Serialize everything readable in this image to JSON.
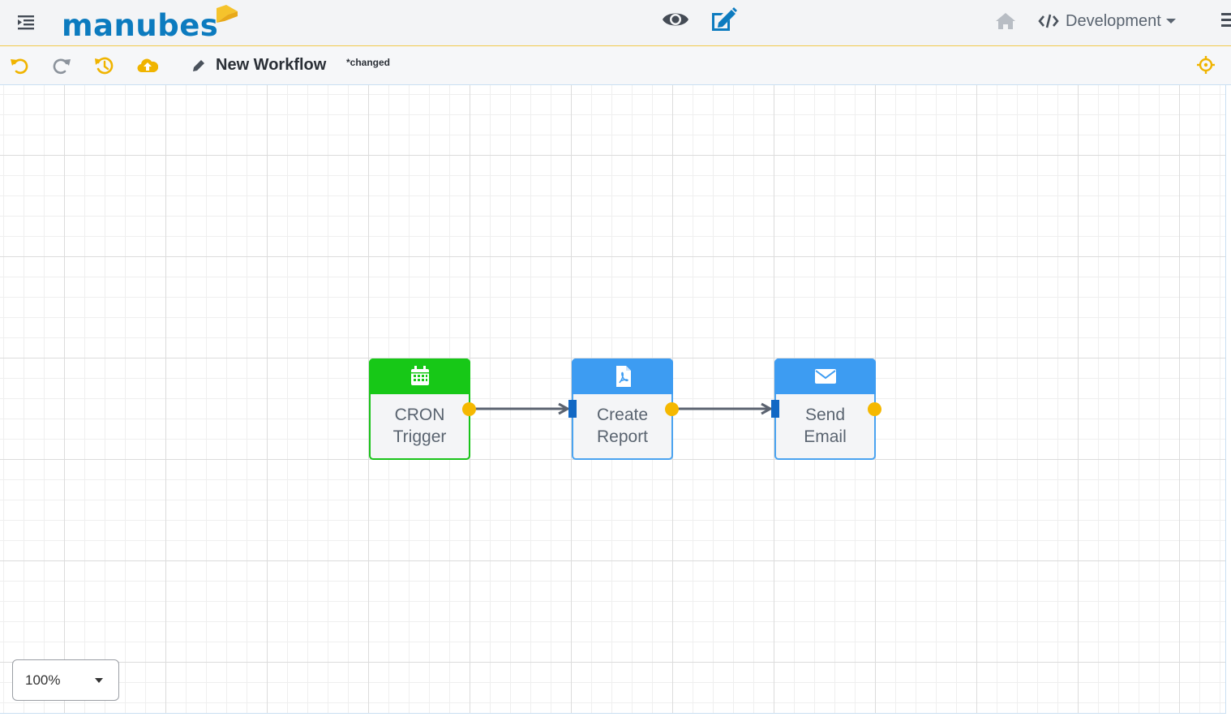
{
  "header": {
    "logo_text": "manubes",
    "menu_icon": "menu-indent-icon",
    "view_icon": "eye-icon",
    "edit_icon": "edit-square-icon",
    "home_icon": "home-icon",
    "environment": {
      "icon": "code-icon",
      "label": "Development"
    },
    "right_menu_icon": "hamburger-icon"
  },
  "toolbar": {
    "undo_icon": "undo-icon",
    "redo_icon": "redo-icon",
    "history_icon": "history-icon",
    "deploy_icon": "cloud-upload-icon",
    "title": "New Workflow",
    "status": "*changed",
    "center_icon": "crosshair-icon"
  },
  "workflow": {
    "nodes": [
      {
        "id": "cron",
        "kind": "trigger",
        "icon": "calendar-icon",
        "line1": "CRON",
        "line2": "Trigger"
      },
      {
        "id": "report",
        "kind": "action",
        "icon": "pdf-file-icon",
        "line1": "Create",
        "line2": "Report"
      },
      {
        "id": "email",
        "kind": "action",
        "icon": "envelope-icon",
        "line1": "Send",
        "line2": "Email"
      }
    ],
    "connections": [
      {
        "from": "cron",
        "to": "report"
      },
      {
        "from": "report",
        "to": "email"
      }
    ]
  },
  "zoom": {
    "value": "100%"
  },
  "colors": {
    "brand": "#0c7bbf",
    "accent": "#f5b800",
    "trigger": "#17c817",
    "action": "#3d9cf2",
    "port_in": "#1268c4"
  }
}
